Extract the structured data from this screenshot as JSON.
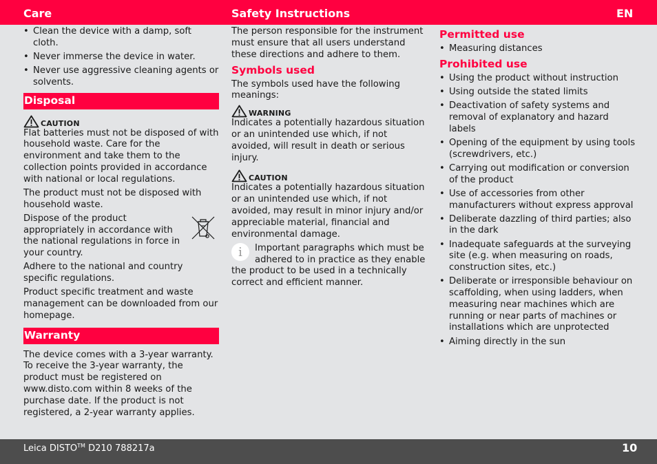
{
  "header": {
    "left": "Care",
    "center": "Safety Instructions",
    "lang": "EN"
  },
  "care": {
    "bullets": [
      "Clean the device with a damp, soft cloth.",
      "Never immerse the device in water.",
      "Never use aggressive cleaning agents or solvents."
    ]
  },
  "disposal": {
    "title": "Disposal",
    "caution_label": "CAUTION",
    "caution_text": "Flat batteries must not be disposed of with household waste. Care for the environment and take them to the collection points provided in accordance with national or local regulations.",
    "p1": "The product must not be disposed with household waste.",
    "p2": "Dispose of the product appropriately in accordance with the national regulations in force in your country.",
    "p3": "Adhere to the national and country specific regulations.",
    "p4": "Product specific treatment and waste management can be downloaded from our homepage.",
    "icon": "crossed-out-wheelie-bin-icon"
  },
  "warranty": {
    "title": "Warranty",
    "text": "The device comes with a 3-year warranty. To receive the 3-year warranty, the product must be registered on www.disto.com within 8 weeks of the purchase date. If the product is not registered, a 2-year warranty applies."
  },
  "safety": {
    "intro": "The person responsible for the instrument must ensure that all users understand these directions and adhere to them.",
    "symbols_title": "Symbols used",
    "symbols_intro": "The symbols used have the following meanings:",
    "warning_label": "WARNING",
    "warning_text": "Indicates a potentially hazardous situation or an unintended use which, if not avoided, will result in death or serious injury.",
    "caution_label": "CAUTION",
    "caution_text": "Indicates a potentially hazardous situation or an unintended use which, if not avoided, may result in minor injury and/or appreciable material, financial and environmental damage.",
    "info_glyph": "i",
    "info_text": "Important paragraphs which must be adhered to in practice as they enable the product to be used in a technically correct and efficient manner."
  },
  "permitted": {
    "title": "Permitted use",
    "items": [
      "Measuring distances"
    ]
  },
  "prohibited": {
    "title": "Prohibited use",
    "items": [
      "Using the product without instruction",
      "Using outside the stated limits",
      "Deactivation of safety systems and removal of explanatory and hazard labels",
      "Opening of the equipment by using tools (screwdrivers, etc.)",
      "Carrying out modification or conversion of the product",
      "Use of accessories from other manufacturers without express approval",
      "Deliberate dazzling of third parties; also in the dark",
      "Inadequate safeguards at the surveying site (e.g. when measuring on roads, construction sites, etc.)",
      "Deliberate or irresponsible behaviour on scaffolding, when using ladders, when measuring near machines which are running or near parts of machines or installations which are unprotected",
      "Aiming directly in the sun"
    ]
  },
  "footer": {
    "product": "Leica DISTO",
    "tm": "TM",
    "model": " D210 788217a",
    "page": "10"
  },
  "colors": {
    "accent": "#ff0040",
    "background": "#e3e4e6",
    "footer": "#4d4d4d"
  }
}
